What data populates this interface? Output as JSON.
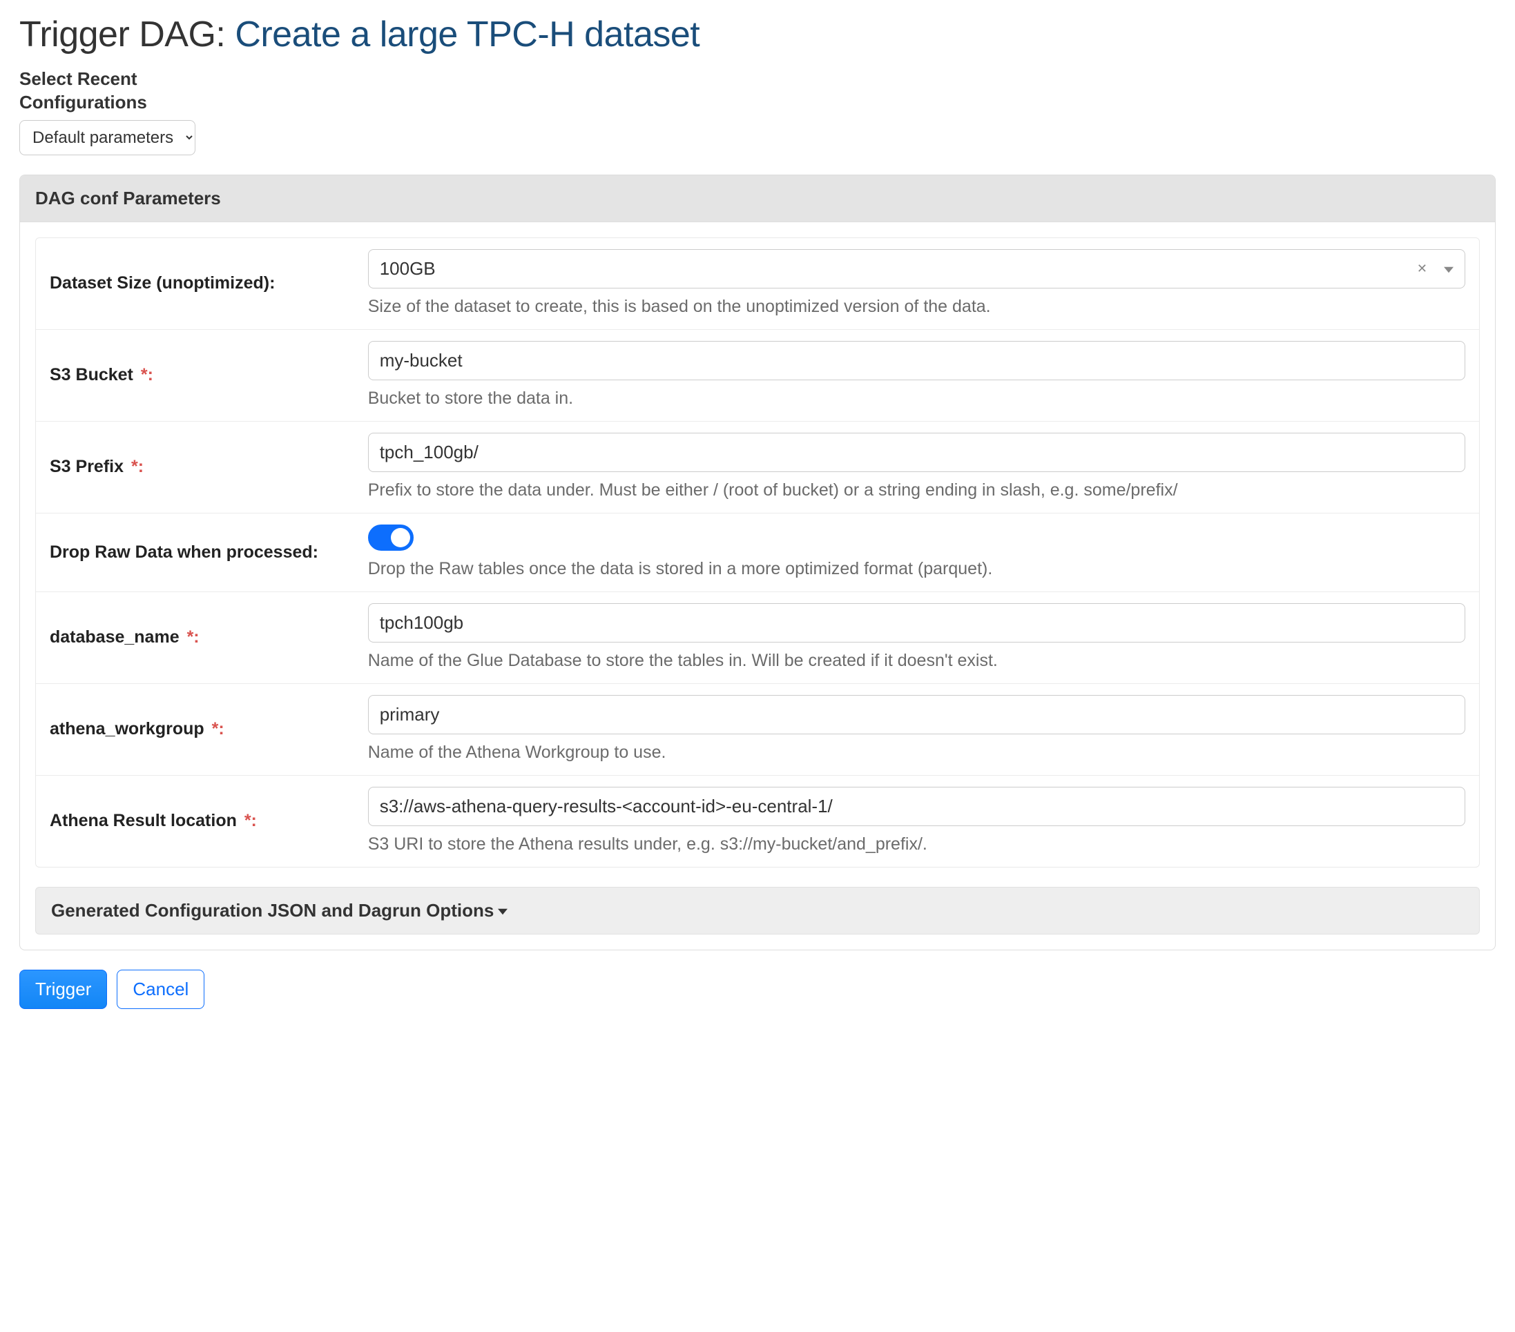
{
  "page": {
    "title_prefix": "Trigger DAG: ",
    "dag_display_name": "Create a large TPC-H dataset"
  },
  "recent": {
    "label_line1": "Select Recent",
    "label_line2": "Configurations",
    "selected": "Default parameters"
  },
  "panel": {
    "heading": "DAG conf Parameters"
  },
  "params": {
    "dataset_size": {
      "label": "Dataset Size (unoptimized):",
      "value": "100GB",
      "help": "Size of the dataset to create, this is based on the unoptimized version of the data."
    },
    "s3_bucket": {
      "label": "S3 Bucket",
      "required_marker": "*:",
      "value": "my-bucket",
      "help": "Bucket to store the data in."
    },
    "s3_prefix": {
      "label": "S3 Prefix",
      "required_marker": "*:",
      "value": "tpch_100gb/",
      "help": "Prefix to store the data under. Must be either / (root of bucket) or a string ending in slash, e.g. some/prefix/"
    },
    "drop_raw": {
      "label": "Drop Raw Data when processed:",
      "value": true,
      "help": "Drop the Raw tables once the data is stored in a more optimized format (parquet)."
    },
    "database_name": {
      "label": "database_name",
      "required_marker": "*:",
      "value": "tpch100gb",
      "help": "Name of the Glue Database to store the tables in. Will be created if it doesn't exist."
    },
    "athena_workgroup": {
      "label": "athena_workgroup",
      "required_marker": "*:",
      "value": "primary",
      "help": "Name of the Athena Workgroup to use."
    },
    "athena_result_location": {
      "label": "Athena Result location",
      "required_marker": "*:",
      "value": "s3://aws-athena-query-results-<account-id>-eu-central-1/",
      "help": "S3 URI to store the Athena results under, e.g. s3://my-bucket/and_prefix/."
    }
  },
  "collapse": {
    "label": "Generated Configuration JSON and Dagrun Options"
  },
  "buttons": {
    "trigger": "Trigger",
    "cancel": "Cancel"
  }
}
